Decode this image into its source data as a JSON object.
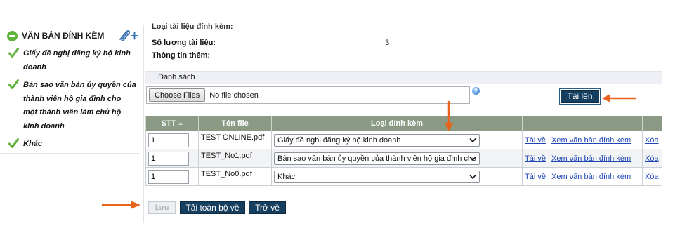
{
  "sidebar": {
    "title": "VĂN BẢN ĐÍNH KÈM",
    "items": [
      {
        "label": "Giấy đề nghị đăng ký hộ kinh doanh"
      },
      {
        "label": "Bản sao văn bản ủy quyền của thành viên hộ gia đình cho một thành viên làm chủ hộ kinh doanh"
      },
      {
        "label": "Khác"
      }
    ]
  },
  "info": {
    "doc_type_label": "Loại tài liệu đính kèm:",
    "doc_count_label": "Số lượng tài liệu:",
    "doc_count_value": "3",
    "extra_label": "Thông tin thêm:"
  },
  "list_section": {
    "header": "Danh sách",
    "choose_files_label": "Choose Files",
    "no_file_text": "No file chosen",
    "help_symbol": "?",
    "upload_label": "Tải lên"
  },
  "table": {
    "headers": {
      "stt": "STT",
      "file_name": "Tên file",
      "attach_type": "Loại đính kèm"
    },
    "rows": [
      {
        "stt": "1",
        "file_name": "TEST ONLINE.pdf",
        "attach_type": "Giấy đề nghị đăng ký hộ kinh doanh",
        "download": "Tải về",
        "view": "Xem văn bản đính kèm",
        "delete": "Xóa"
      },
      {
        "stt": "1",
        "file_name": "TEST_No1.pdf",
        "attach_type": "Bản sao văn bản ủy quyền của thành viên hộ gia đình cho một",
        "download": "Tải về",
        "view": "Xem văn bản đính kèm",
        "delete": "Xóa"
      },
      {
        "stt": "1",
        "file_name": "TEST_No0.pdf",
        "attach_type": "Khác",
        "download": "Tải về",
        "view": "Xem văn bản đính kèm",
        "delete": "Xóa"
      }
    ]
  },
  "actions": {
    "save_label": "Lưu",
    "download_all_label": "Tải toàn bộ về",
    "back_label": "Trở về"
  },
  "colors": {
    "primary_button": "#163e5f",
    "table_header": "#8a9a84",
    "annotation_arrow": "#e8631c",
    "check_green": "#5fb33b",
    "link": "#1f46b5"
  }
}
